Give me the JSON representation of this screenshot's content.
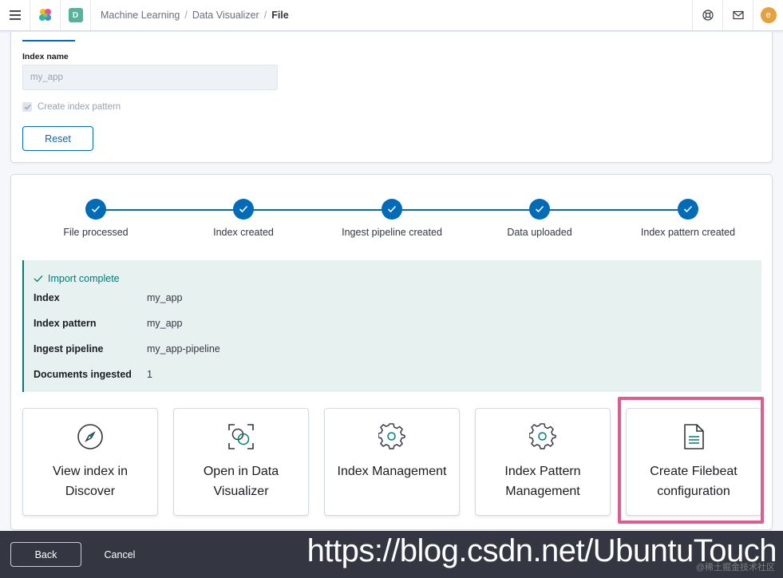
{
  "header": {
    "breadcrumbs": [
      "Machine Learning",
      "Data Visualizer",
      "File"
    ],
    "space_initial": "D",
    "user_initial": "e",
    "brand_color": "#54b399"
  },
  "settings": {
    "index_name_label": "Index name",
    "index_name_value": "my_app",
    "create_index_pattern_label": "Create index pattern",
    "create_index_pattern_checked": true,
    "reset_label": "Reset"
  },
  "steps": [
    {
      "label": "File processed",
      "done": true
    },
    {
      "label": "Index created",
      "done": true
    },
    {
      "label": "Ingest pipeline created",
      "done": true
    },
    {
      "label": "Data uploaded",
      "done": true
    },
    {
      "label": "Index pattern created",
      "done": true
    }
  ],
  "import_result": {
    "title": "Import complete",
    "rows": [
      {
        "key": "Index",
        "value": "my_app"
      },
      {
        "key": "Index pattern",
        "value": "my_app"
      },
      {
        "key": "Ingest pipeline",
        "value": "my_app-pipeline"
      },
      {
        "key": "Documents ingested",
        "value": "1"
      }
    ]
  },
  "actions": [
    {
      "title": "View index in Discover",
      "icon": "compass-icon"
    },
    {
      "title": "Open in Data Visualizer",
      "icon": "data-visualizer-icon"
    },
    {
      "title": "Index Management",
      "icon": "gear-icon"
    },
    {
      "title": "Index Pattern Management",
      "icon": "gear-icon"
    },
    {
      "title": "Create Filebeat configuration",
      "icon": "document-icon"
    }
  ],
  "footer": {
    "back_label": "Back",
    "cancel_label": "Cancel",
    "watermark": "https://blog.csdn.net/UbuntuTouch",
    "watermark_small": "@稀土掘金技术社区"
  },
  "colors": {
    "primary": "#006bb8",
    "success": "#017d73",
    "callout_bg": "#e6f1f0",
    "highlight": "#de5d8e",
    "footer_bg": "#343741"
  }
}
